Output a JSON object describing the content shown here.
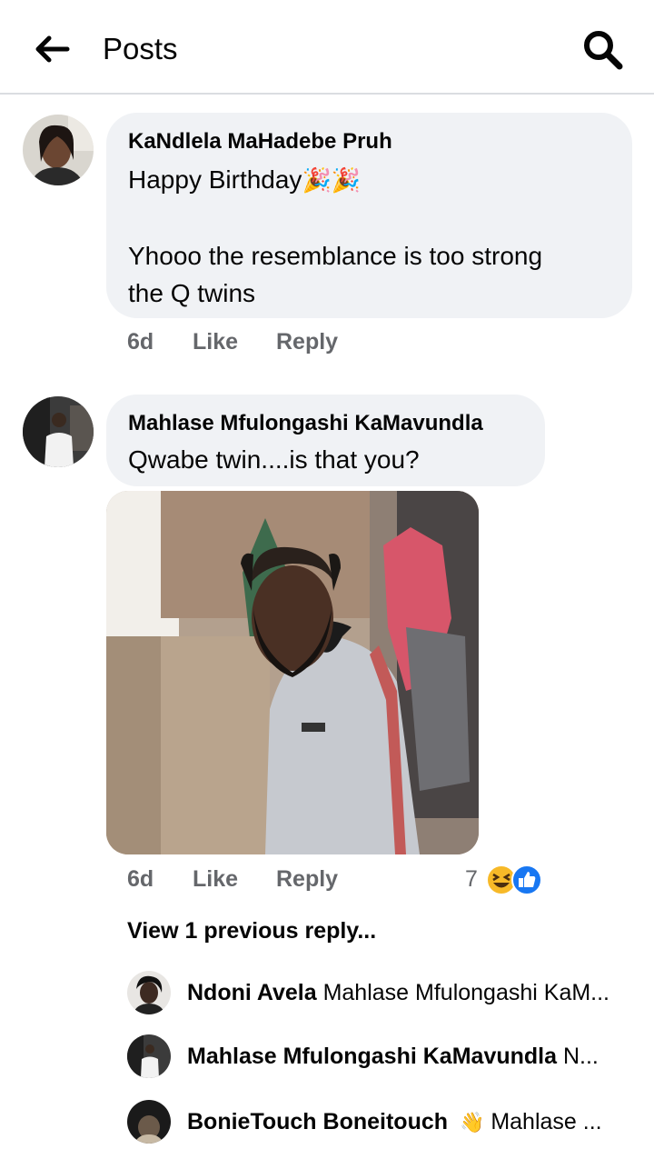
{
  "header": {
    "title": "Posts",
    "back_icon": "arrow-left-icon",
    "search_icon": "search-icon"
  },
  "comments": [
    {
      "author": "KaNdlela MaHadebe Pruh",
      "line1": "Happy Birthday",
      "line1_emoji": "🎉🎉",
      "line2": "Yhooo the resemblance is too strong",
      "line3": "the Q twins",
      "time": "6d",
      "like": "Like",
      "reply": "Reply"
    },
    {
      "author": "Mahlase Mfulongashi KaMavundla",
      "text": "Qwabe twin....is that you?",
      "time": "6d",
      "like": "Like",
      "reply": "Reply",
      "reaction_count": "7",
      "reaction_icons": [
        "laugh-reaction-icon",
        "like-reaction-icon"
      ],
      "has_photo": true
    }
  ],
  "view_previous": "View 1 previous reply...",
  "replies": [
    {
      "name": "Ndoni Avela",
      "preview": "Mahlase Mfulongashi KaM..."
    },
    {
      "name": "Mahlase Mfulongashi KaMavundla",
      "preview": "N..."
    },
    {
      "name": "BonieTouch Boneitouch",
      "emoji": "👋",
      "preview": "Mahlase ..."
    }
  ],
  "colors": {
    "bubble": "#f0f2f5",
    "meta": "#65676b",
    "like_blue": "#1877f2",
    "laugh_yellow": "#f7b928"
  }
}
